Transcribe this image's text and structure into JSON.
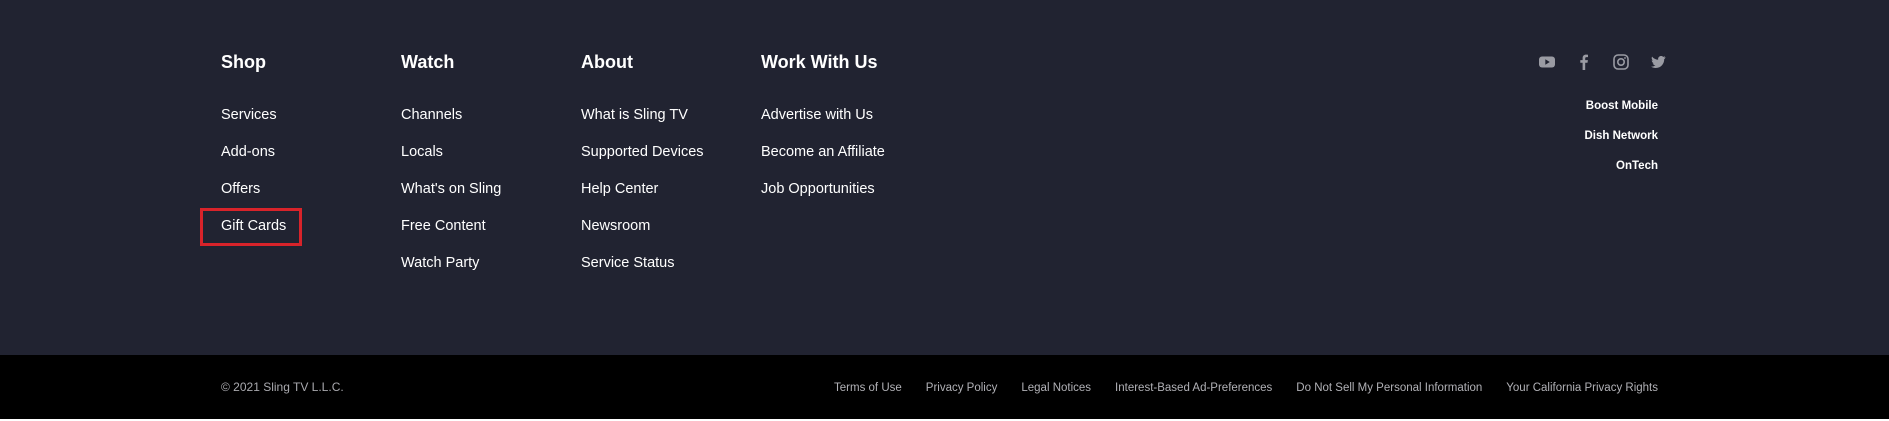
{
  "columns": [
    {
      "heading": "Shop",
      "links": [
        "Services",
        "Add-ons",
        "Offers",
        "Gift Cards"
      ]
    },
    {
      "heading": "Watch",
      "links": [
        "Channels",
        "Locals",
        "What's on Sling",
        "Free Content",
        "Watch Party"
      ]
    },
    {
      "heading": "About",
      "links": [
        "What is Sling TV",
        "Supported Devices",
        "Help Center",
        "Newsroom",
        "Service Status"
      ]
    },
    {
      "heading": "Work With Us",
      "links": [
        "Advertise with Us",
        "Become an Affiliate",
        "Job Opportunities"
      ]
    }
  ],
  "social": [
    "youtube-icon",
    "facebook-icon",
    "instagram-icon",
    "twitter-icon"
  ],
  "partners": [
    "Boost Mobile",
    "Dish Network",
    "OnTech"
  ],
  "copyright": "© 2021 Sling TV L.L.C.",
  "legal": [
    "Terms of Use",
    "Privacy Policy",
    "Legal Notices",
    "Interest-Based Ad-Preferences",
    "Do Not Sell My Personal Information",
    "Your California Privacy Rights"
  ],
  "colors": {
    "footer_bg": "#212331",
    "bottom_bar_bg": "#000000",
    "highlight": "#d8232a",
    "icon": "#9a9ba3"
  }
}
